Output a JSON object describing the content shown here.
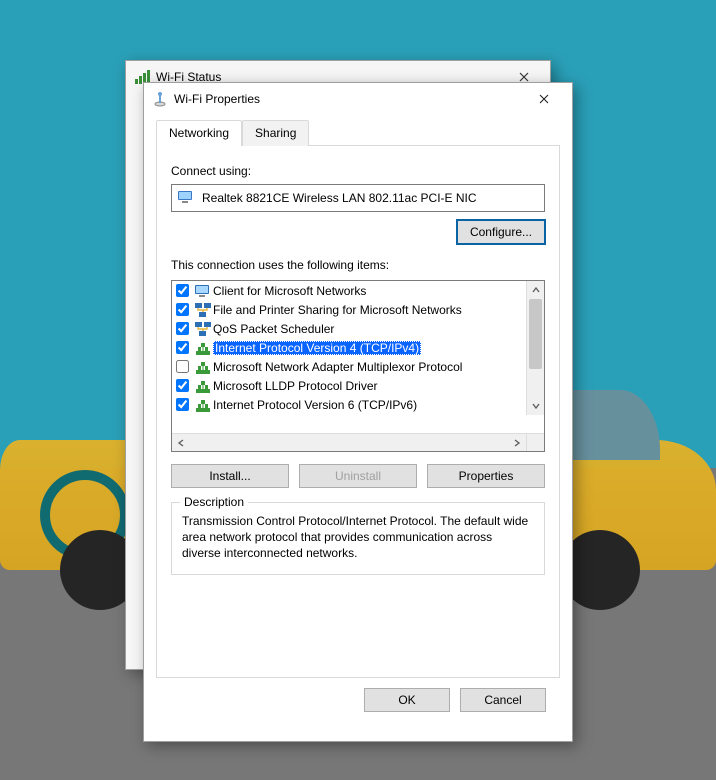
{
  "back_window": {
    "title": "Wi-Fi Status"
  },
  "window": {
    "title": "Wi-Fi Properties",
    "tabs": {
      "networking": "Networking",
      "sharing": "Sharing"
    },
    "connect_using_label": "Connect using:",
    "adapter": "Realtek 8821CE Wireless LAN 802.11ac PCI-E NIC",
    "configure_btn": "Configure...",
    "items_label": "This connection uses the following items:",
    "items": [
      {
        "checked": true,
        "icon": "client",
        "label": "Client for Microsoft Networks"
      },
      {
        "checked": true,
        "icon": "service",
        "label": "File and Printer Sharing for Microsoft Networks"
      },
      {
        "checked": true,
        "icon": "service",
        "label": "QoS Packet Scheduler"
      },
      {
        "checked": true,
        "icon": "protocol",
        "label": "Internet Protocol Version 4 (TCP/IPv4)",
        "selected": true
      },
      {
        "checked": false,
        "icon": "protocol",
        "label": "Microsoft Network Adapter Multiplexor Protocol"
      },
      {
        "checked": true,
        "icon": "protocol",
        "label": "Microsoft LLDP Protocol Driver"
      },
      {
        "checked": true,
        "icon": "protocol",
        "label": "Internet Protocol Version 6 (TCP/IPv6)"
      }
    ],
    "install_btn": "Install...",
    "uninstall_btn": "Uninstall",
    "properties_btn": "Properties",
    "description_legend": "Description",
    "description_text": "Transmission Control Protocol/Internet Protocol. The default wide area network protocol that provides communication across diverse interconnected networks.",
    "ok_btn": "OK",
    "cancel_btn": "Cancel"
  }
}
